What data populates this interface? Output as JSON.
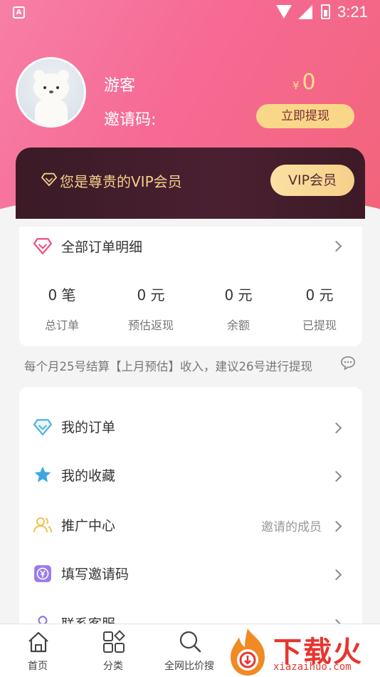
{
  "status_bar": {
    "time": "3:21",
    "app_icon_letter": "A"
  },
  "profile": {
    "name": "游客",
    "invite_label": "邀请码:",
    "currency_symbol": "¥",
    "balance": "0",
    "withdraw_button": "立即提现"
  },
  "vip": {
    "text": "您是尊贵的VIP会员",
    "button": "VIP会员"
  },
  "orders": {
    "title": "全部订单明细",
    "stats": [
      {
        "value": "0 笔",
        "label": "总订单"
      },
      {
        "value": "0 元",
        "label": "预估返现"
      },
      {
        "value": "0 元",
        "label": "余额"
      },
      {
        "value": "0 元",
        "label": "已提现"
      }
    ]
  },
  "notice": "每个月25号结算【上月预估】收入，建议26号进行提现",
  "menu": [
    {
      "label": "我的订单",
      "icon": "diamond-icon",
      "extra": ""
    },
    {
      "label": "我的收藏",
      "icon": "star-icon",
      "extra": ""
    },
    {
      "label": "推广中心",
      "icon": "users-icon",
      "extra": "邀请的成员"
    },
    {
      "label": "填写邀请码",
      "icon": "yen-icon",
      "extra": ""
    },
    {
      "label": "联系客服",
      "icon": "service-icon",
      "extra": ""
    }
  ],
  "tabs": [
    {
      "label": "首页",
      "icon": "home-icon"
    },
    {
      "label": "分类",
      "icon": "category-icon"
    },
    {
      "label": "全网比价搜",
      "icon": "search-icon"
    }
  ],
  "watermark": {
    "text": "下载火",
    "sub": "xiazaihuo.com"
  },
  "colors": {
    "header_pink": "#f66a95",
    "gold": "#f9d788",
    "vip_dark": "#3b1a26"
  }
}
